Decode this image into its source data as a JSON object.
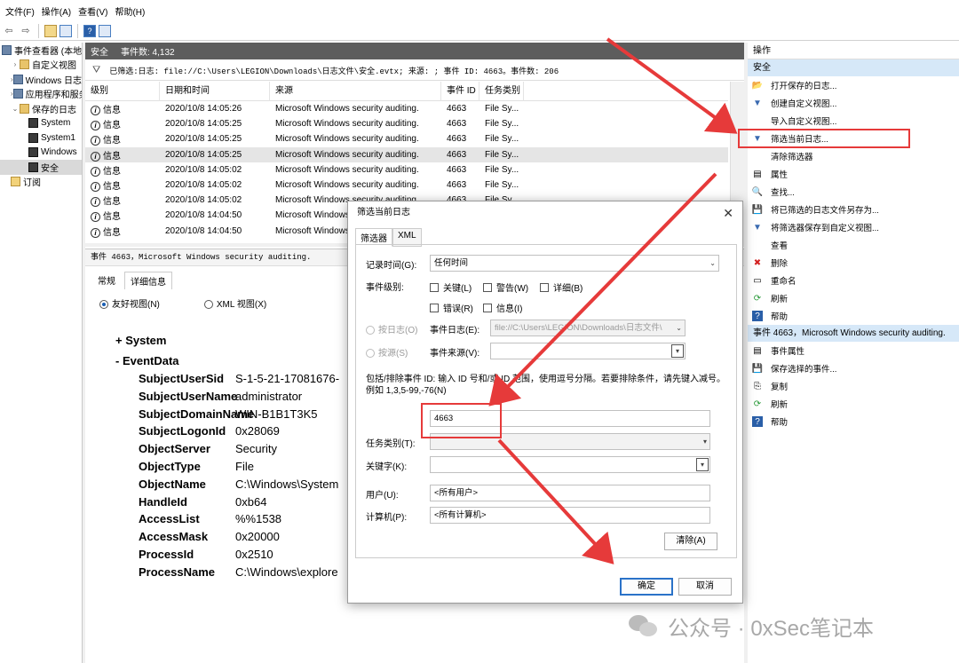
{
  "menu": [
    "文件(F)",
    "操作(A)",
    "查看(V)",
    "帮助(H)"
  ],
  "toolbar": {
    "back": "⇦",
    "forward": "⇨"
  },
  "tree": [
    {
      "label": "事件查看器 (本地)",
      "expander": "",
      "icon": "log"
    },
    {
      "label": "自定义视图",
      "expander": "›",
      "icon": "folder"
    },
    {
      "label": "Windows 日志",
      "expander": "›",
      "icon": "log"
    },
    {
      "label": "应用程序和服务",
      "expander": "›",
      "icon": "log"
    },
    {
      "label": "保存的日志",
      "expander": "⌄",
      "icon": "folder"
    },
    {
      "label": "System",
      "expander": "",
      "icon": "disk"
    },
    {
      "label": "System1",
      "expander": "",
      "icon": "disk"
    },
    {
      "label": "Windows",
      "expander": "",
      "icon": "disk"
    },
    {
      "label": "安全",
      "expander": "",
      "icon": "disk"
    },
    {
      "label": "订阅",
      "expander": "",
      "icon": "sub"
    }
  ],
  "header": {
    "log_name": "安全",
    "event_count": "事件数: 4,132"
  },
  "filter_text": "已筛选:日志: file://C:\\Users\\LEGION\\Downloads\\日志文件\\安全.evtx; 来源: ; 事件 ID: 4663。事件数: 206",
  "columns": [
    "级别",
    "日期和时间",
    "来源",
    "事件 ID",
    "任务类别"
  ],
  "rows": [
    {
      "level": "信息",
      "time": "2020/10/8 14:05:26",
      "source": "Microsoft Windows security auditing.",
      "id": "4663",
      "cat": "File Sy..."
    },
    {
      "level": "信息",
      "time": "2020/10/8 14:05:25",
      "source": "Microsoft Windows security auditing.",
      "id": "4663",
      "cat": "File Sy..."
    },
    {
      "level": "信息",
      "time": "2020/10/8 14:05:25",
      "source": "Microsoft Windows security auditing.",
      "id": "4663",
      "cat": "File Sy..."
    },
    {
      "level": "信息",
      "time": "2020/10/8 14:05:25",
      "source": "Microsoft Windows security auditing.",
      "id": "4663",
      "cat": "File Sy..."
    },
    {
      "level": "信息",
      "time": "2020/10/8 14:05:02",
      "source": "Microsoft Windows security auditing.",
      "id": "4663",
      "cat": "File Sy..."
    },
    {
      "level": "信息",
      "time": "2020/10/8 14:05:02",
      "source": "Microsoft Windows security auditing.",
      "id": "4663",
      "cat": "File Sy..."
    },
    {
      "level": "信息",
      "time": "2020/10/8 14:05:02",
      "source": "Microsoft Windows security auditing.",
      "id": "4663",
      "cat": "File Sy..."
    },
    {
      "level": "信息",
      "time": "2020/10/8 14:04:50",
      "source": "Microsoft Windows security auditing.",
      "id": "4663",
      "cat": "File Sy..."
    },
    {
      "level": "信息",
      "time": "2020/10/8 14:04:50",
      "source": "Microsoft Windows security auditing.",
      "id": "4663",
      "cat": "File Sy..."
    }
  ],
  "detail": {
    "title": "事件 4663，Microsoft Windows security auditing.",
    "tabs": [
      "常规",
      "详细信息"
    ],
    "view_friendly": "友好视图(N)",
    "view_xml": "XML 视图(X)",
    "system": "+ System",
    "eventdata": "- EventData",
    "fields": [
      {
        "k": "SubjectUserSid",
        "v": "S-1-5-21-17081676-"
      },
      {
        "k": "SubjectUserName",
        "v": "administrator"
      },
      {
        "k": "SubjectDomainName",
        "v": "WIN-B1B1T3K5"
      },
      {
        "k": "SubjectLogonId",
        "v": "0x28069"
      },
      {
        "k": "ObjectServer",
        "v": "Security"
      },
      {
        "k": "ObjectType",
        "v": "File"
      },
      {
        "k": "ObjectName",
        "v": "C:\\Windows\\System"
      },
      {
        "k": "HandleId",
        "v": "0xb64"
      },
      {
        "k": "AccessList",
        "v": "%%1538"
      },
      {
        "k": "AccessMask",
        "v": "0x20000"
      },
      {
        "k": "ProcessId",
        "v": "0x2510"
      },
      {
        "k": "ProcessName",
        "v": "C:\\Windows\\explore"
      }
    ]
  },
  "actions": {
    "title": "操作",
    "section1": "安全",
    "items1": [
      {
        "label": "打开保存的日志...",
        "icon": "📂"
      },
      {
        "label": "创建自定义视图...",
        "icon": "▼"
      },
      {
        "label": "导入自定义视图...",
        "icon": ""
      },
      {
        "label": "筛选当前日志...",
        "icon": "▼"
      },
      {
        "label": "清除筛选器",
        "icon": ""
      },
      {
        "label": "属性",
        "icon": "▤"
      },
      {
        "label": "查找...",
        "icon": "🔍"
      },
      {
        "label": "将已筛选的日志文件另存为...",
        "icon": "💾"
      },
      {
        "label": "将筛选器保存到自定义视图...",
        "icon": "▼"
      },
      {
        "label": "查看",
        "icon": ""
      },
      {
        "label": "删除",
        "icon": "✖"
      },
      {
        "label": "重命名",
        "icon": "▭"
      },
      {
        "label": "刷新",
        "icon": "⟳"
      },
      {
        "label": "帮助",
        "icon": "?"
      }
    ],
    "section2": "事件 4663，Microsoft Windows security auditing.",
    "items2": [
      {
        "label": "事件属性",
        "icon": "▤"
      },
      {
        "label": "保存选择的事件...",
        "icon": "💾"
      },
      {
        "label": "复制",
        "icon": "⎘"
      },
      {
        "label": "刷新",
        "icon": "⟳"
      },
      {
        "label": "帮助",
        "icon": "?"
      }
    ]
  },
  "dialog": {
    "title": "筛选当前日志",
    "close": "✕",
    "tab_filter": "筛选器",
    "tab_xml": "XML",
    "logged_label": "记录时间(G):",
    "logged_value": "任何时间",
    "level_label": "事件级别:",
    "levels": [
      "关键(L)",
      "警告(W)",
      "详细(B)",
      "错误(R)",
      "信息(I)"
    ],
    "by_log": "按日志(O)",
    "by_source": "按源(S)",
    "event_log_label": "事件日志(E):",
    "event_log_value": "file://C:\\Users\\LEGION\\Downloads\\日志文件\\",
    "event_source_label": "事件来源(V):",
    "hint": "包括/排除事件 ID: 输入 ID 号和/或 ID 范围，使用逗号分隔。若要排除条件，请先键入减号。例如 1,3,5-99,-76(N)",
    "event_id_value": "4663",
    "task_label": "任务类别(T):",
    "keyword_label": "关键字(K):",
    "user_label": "用户(U):",
    "user_value": "<所有用户>",
    "computer_label": "计算机(P):",
    "computer_value": "<所有计算机>",
    "clear_btn": "清除(A)",
    "ok_btn": "确定",
    "cancel_btn": "取消"
  },
  "watermark": "公众号 · 0xSec笔记本",
  "colors": {
    "arrow": "#e63a3a",
    "header_bg": "#5d5d5d",
    "action_section": "#d6e8f8"
  }
}
